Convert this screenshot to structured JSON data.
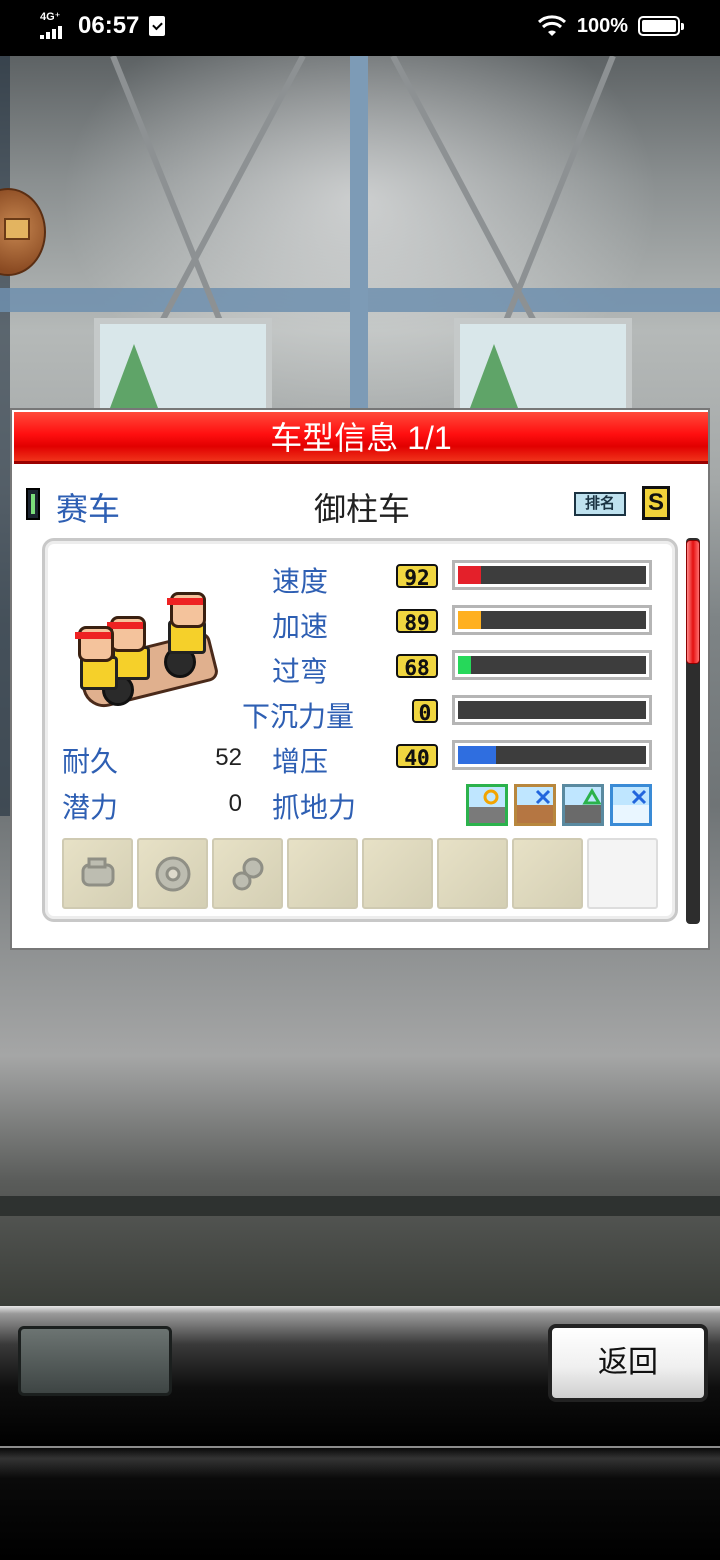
{
  "status_bar": {
    "network": "4G⁺",
    "time": "06:57",
    "battery": "100%"
  },
  "dialog": {
    "title": "车型信息 1/1",
    "category": "赛车",
    "car_name": "御柱车",
    "rank_label": "排名",
    "rank": "S"
  },
  "stats": {
    "speed": {
      "label": "速度",
      "value": "92",
      "fraction": 0.12,
      "color": "#e4202a"
    },
    "accel": {
      "label": "加速",
      "value": "89",
      "fraction": 0.12,
      "color": "#ffb020"
    },
    "cornering": {
      "label": "过弯",
      "value": "68",
      "fraction": 0.07,
      "color": "#26d85a"
    },
    "downforce": {
      "label": "下沉力量",
      "value": "0",
      "fraction": 0.0,
      "color": "#888888"
    },
    "boost": {
      "label": "增压",
      "value": "40",
      "fraction": 0.2,
      "color": "#2f6ee0"
    },
    "durability": {
      "label": "耐久",
      "value": "52"
    },
    "potential": {
      "label": "潜力",
      "value": "0"
    },
    "grip": {
      "label": "抓地力"
    }
  },
  "grip_icons": [
    "flat-road-ok-icon",
    "dirt-road-no-icon",
    "rough-road-ok-icon",
    "snow-road-no-icon"
  ],
  "part_slots": [
    "engine-part-icon",
    "tire-part-icon",
    "gear-part-icon",
    "",
    "",
    "",
    "",
    ""
  ],
  "buttons": {
    "back": "返回"
  }
}
